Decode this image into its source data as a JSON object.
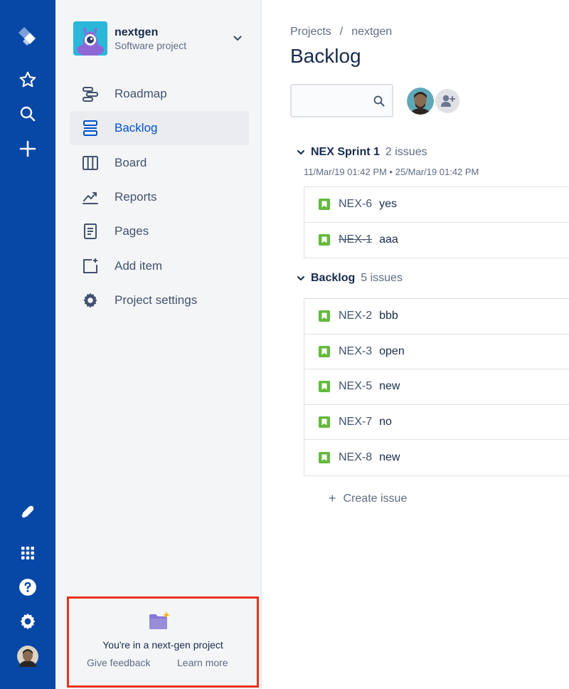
{
  "project": {
    "name": "nextgen",
    "type": "Software project"
  },
  "nav": {
    "items": [
      {
        "label": "Roadmap",
        "icon": "roadmap-icon"
      },
      {
        "label": "Backlog",
        "icon": "backlog-icon",
        "active": true
      },
      {
        "label": "Board",
        "icon": "board-icon"
      },
      {
        "label": "Reports",
        "icon": "reports-icon"
      },
      {
        "label": "Pages",
        "icon": "pages-icon"
      },
      {
        "label": "Add item",
        "icon": "add-item-icon"
      },
      {
        "label": "Project settings",
        "icon": "gear-icon"
      }
    ]
  },
  "nextgen_banner": {
    "text": "You're in a next-gen project",
    "feedback_label": "Give feedback",
    "learn_label": "Learn more"
  },
  "breadcrumb": {
    "root": "Projects",
    "separator": "/",
    "current": "nextgen"
  },
  "page": {
    "title": "Backlog"
  },
  "search": {
    "value": "",
    "placeholder": ""
  },
  "sprint": {
    "name": "NEX Sprint 1",
    "count": "2 issues",
    "dates": "11/Mar/19 01:42 PM • 25/Mar/19 01:42 PM",
    "issues": [
      {
        "key": "NEX-6",
        "summary": "yes",
        "done": false
      },
      {
        "key": "NEX-1",
        "summary": "aaa",
        "done": true
      }
    ]
  },
  "backlog": {
    "name": "Backlog",
    "count": "5 issues",
    "issues": [
      {
        "key": "NEX-2",
        "summary": "bbb"
      },
      {
        "key": "NEX-3",
        "summary": "open"
      },
      {
        "key": "NEX-5",
        "summary": "new"
      },
      {
        "key": "NEX-7",
        "summary": "no"
      },
      {
        "key": "NEX-8",
        "summary": "new"
      }
    ]
  },
  "create_issue": {
    "label": "Create issue"
  },
  "colors": {
    "global_nav": "#0747a6",
    "accent": "#0052cc",
    "story": "#63ba3c",
    "highlight_border": "#e8321c"
  }
}
